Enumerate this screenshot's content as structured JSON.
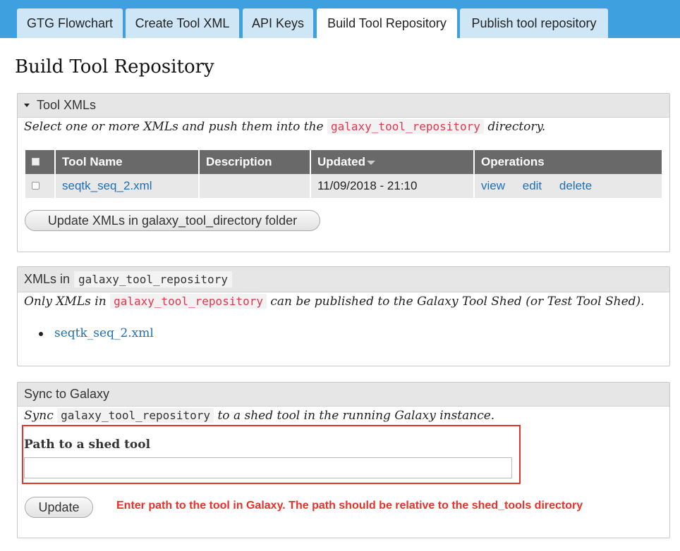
{
  "tabs": [
    {
      "label": "GTG Flowchart"
    },
    {
      "label": "Create Tool XML"
    },
    {
      "label": "API Keys"
    },
    {
      "label": "Build Tool Repository"
    },
    {
      "label": "Publish tool repository"
    }
  ],
  "page_title": "Build Tool Repository",
  "tool_xmls": {
    "header": "Tool XMLs",
    "desc_before": "Select one or more XMLs and push them into the",
    "desc_code": "galaxy_tool_repository",
    "desc_after": "directory.",
    "columns": [
      "Tool Name",
      "Description",
      "Updated",
      "Operations"
    ],
    "rows": [
      {
        "tool_name": "seqtk_seq_2.xml",
        "description": "",
        "updated": "11/09/2018 - 21:10",
        "operations": [
          "view",
          "edit",
          "delete"
        ]
      }
    ],
    "update_button": "Update XMLs in galaxy_tool_directory folder"
  },
  "repo": {
    "header_prefix": "XMLs in",
    "header_code": "galaxy_tool_repository",
    "desc_before": "Only XMLs in",
    "desc_code": "galaxy_tool_repository",
    "desc_after": "can be published to the Galaxy Tool Shed (or Test Tool Shed).",
    "items": [
      "seqtk_seq_2.xml"
    ]
  },
  "sync": {
    "header": "Sync to Galaxy",
    "desc_before": "Sync",
    "desc_code": "galaxy_tool_repository",
    "desc_after": "to a shed tool in the running Galaxy instance.",
    "field_label": "Path to a shed tool",
    "field_value": "",
    "button": "Update",
    "annotation": "Enter path to the tool in Galaxy. The path should be relative to the shed_tools directory"
  },
  "colors": {
    "tab_bar": "#3fa0e0",
    "link": "#1f6fb5",
    "code_red": "#e2364d",
    "annotation_red": "#e8312a",
    "table_header": "#696969"
  }
}
